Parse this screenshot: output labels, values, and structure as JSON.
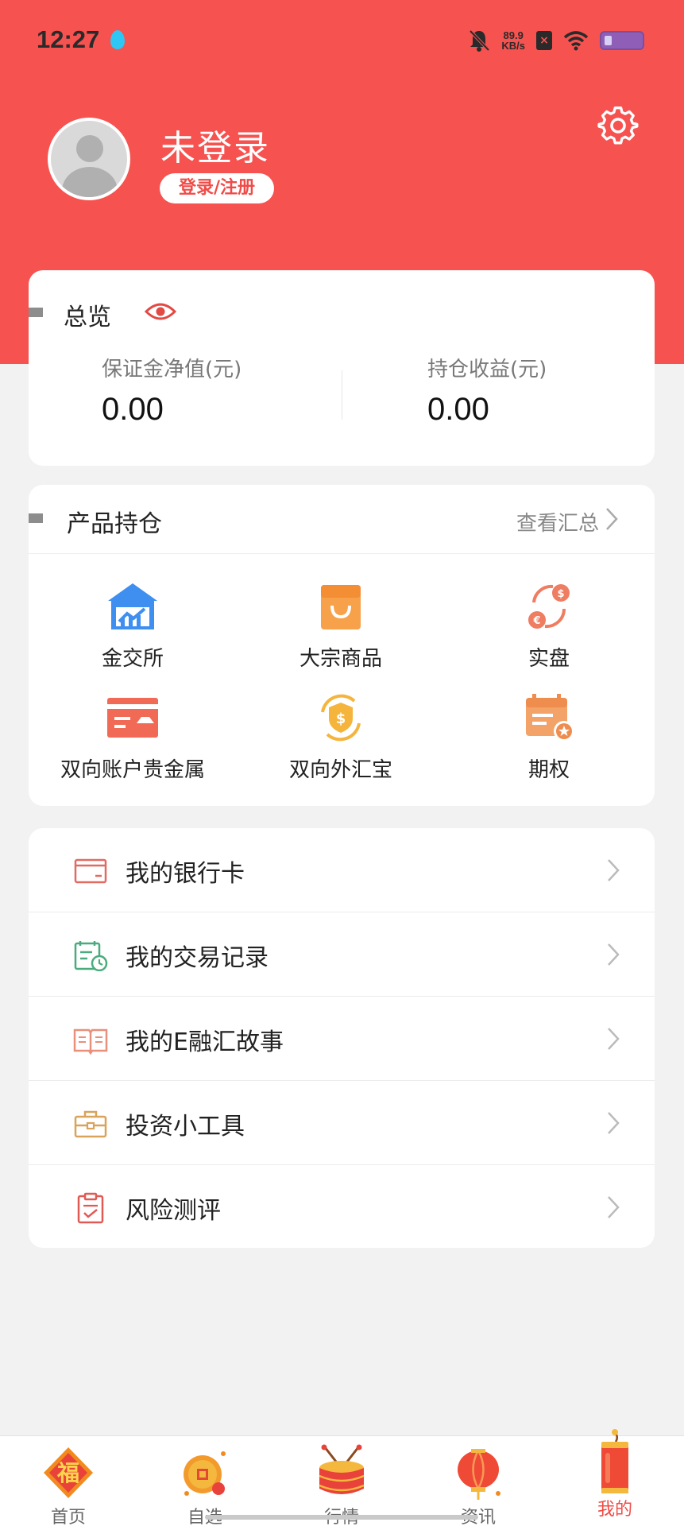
{
  "status_bar": {
    "time": "12:27",
    "speed_value": "89.9",
    "speed_unit": "KB/s"
  },
  "profile": {
    "name": "未登录",
    "login_label": "登录/注册"
  },
  "overview": {
    "title": "总览",
    "margin_label": "保证金净值(元)",
    "margin_value": "0.00",
    "profit_label": "持仓收益(元)",
    "profit_value": "0.00"
  },
  "products": {
    "title": "产品持仓",
    "summary_link": "查看汇总",
    "items": [
      {
        "label": "金交所",
        "icon": "exchange-building-icon"
      },
      {
        "label": "大宗商品",
        "icon": "shopping-bag-icon"
      },
      {
        "label": "实盘",
        "icon": "currency-exchange-icon"
      },
      {
        "label": "双向账户贵金属",
        "icon": "gold-card-icon"
      },
      {
        "label": "双向外汇宝",
        "icon": "shield-dollar-icon"
      },
      {
        "label": "期权",
        "icon": "calendar-star-icon"
      }
    ]
  },
  "menu": {
    "items": [
      {
        "label": "我的银行卡",
        "icon": "bank-card-icon"
      },
      {
        "label": "我的交易记录",
        "icon": "trade-record-icon"
      },
      {
        "label": "我的E融汇故事",
        "icon": "book-icon"
      },
      {
        "label": "投资小工具",
        "icon": "toolbox-icon"
      },
      {
        "label": "风险测评",
        "icon": "clipboard-check-icon"
      }
    ]
  },
  "bottom_nav": {
    "items": [
      {
        "label": "首页",
        "icon": "fu-diamond-icon"
      },
      {
        "label": "自选",
        "icon": "coin-icon"
      },
      {
        "label": "行情",
        "icon": "drum-icon"
      },
      {
        "label": "资讯",
        "icon": "lantern-icon"
      },
      {
        "label": "我的",
        "icon": "firecracker-icon",
        "active": true
      }
    ]
  },
  "colors": {
    "brand_red": "#f65250",
    "accent_red": "#f04c47",
    "background": "#f2f2f2"
  }
}
